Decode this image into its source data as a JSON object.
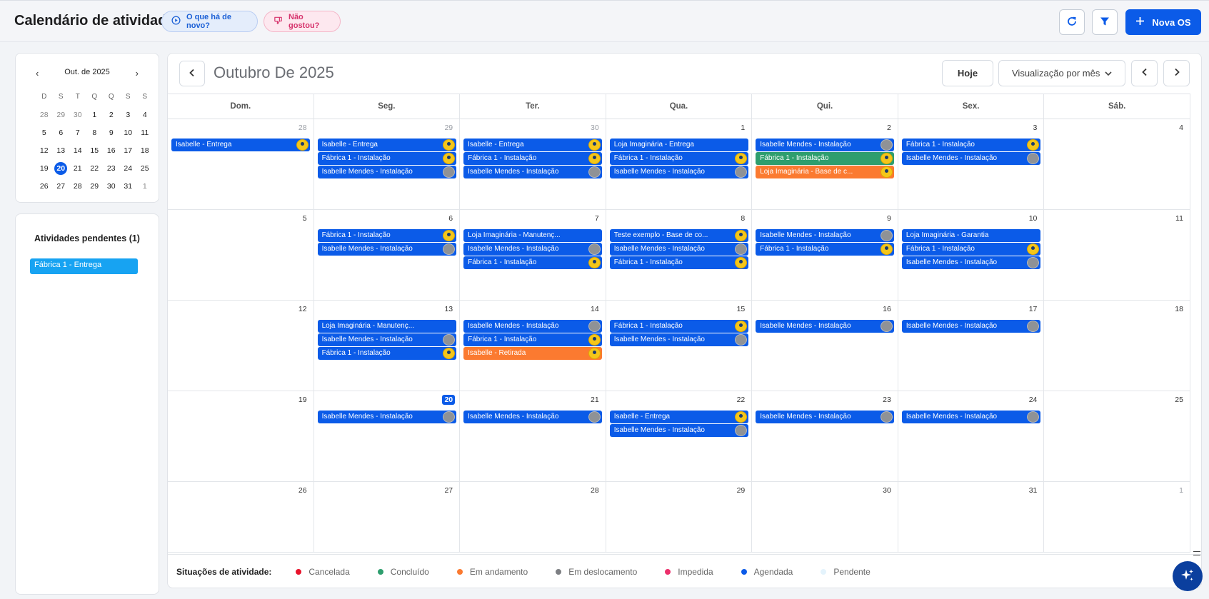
{
  "header": {
    "title": "Calendário de atividades",
    "whats_new": "O que há de novo?",
    "dislike": "Não gostou?",
    "new_os": "Nova OS"
  },
  "mini_calendar": {
    "title": "Out. de 2025",
    "dow": [
      "D",
      "S",
      "T",
      "Q",
      "Q",
      "S",
      "S"
    ],
    "rows": [
      [
        "28",
        "29",
        "30",
        "1",
        "2",
        "3",
        "4"
      ],
      [
        "5",
        "6",
        "7",
        "8",
        "9",
        "10",
        "11"
      ],
      [
        "12",
        "13",
        "14",
        "15",
        "16",
        "17",
        "18"
      ],
      [
        "19",
        "20",
        "21",
        "22",
        "23",
        "24",
        "25"
      ],
      [
        "26",
        "27",
        "28",
        "29",
        "30",
        "31",
        "1"
      ]
    ],
    "selected": "20"
  },
  "pending": {
    "title": "Atividades pendentes (1)",
    "items": [
      "Fábrica 1 - Entrega"
    ]
  },
  "calendar": {
    "title": "Outubro De 2025",
    "today_label": "Hoje",
    "view_label": "Visualização por mês",
    "weekdays": [
      "Dom.",
      "Seg.",
      "Ter.",
      "Qua.",
      "Qui.",
      "Sex.",
      "Sáb."
    ],
    "weeks": [
      [
        {
          "day": "28",
          "muted": true,
          "events": [
            {
              "t": "Isabelle - Entrega",
              "c": "blue",
              "a": "yellow"
            }
          ]
        },
        {
          "day": "29",
          "muted": true,
          "events": [
            {
              "t": "Isabelle - Entrega",
              "c": "blue",
              "a": "yellow"
            },
            {
              "t": "Fábrica 1 - Instalação",
              "c": "blue",
              "a": "yellow"
            },
            {
              "t": "Isabelle Mendes - Instalação",
              "c": "blue",
              "a": "gray"
            }
          ]
        },
        {
          "day": "30",
          "muted": true,
          "events": [
            {
              "t": "Isabelle - Entrega",
              "c": "blue",
              "a": "yellow"
            },
            {
              "t": "Fábrica 1 - Instalação",
              "c": "blue",
              "a": "yellow"
            },
            {
              "t": "Isabelle Mendes - Instalação",
              "c": "blue",
              "a": "gray"
            }
          ]
        },
        {
          "day": "1",
          "events": [
            {
              "t": "Loja Imaginária - Entrega",
              "c": "blue",
              "a": ""
            },
            {
              "t": "Fábrica 1 - Instalação",
              "c": "blue",
              "a": "yellow"
            },
            {
              "t": "Isabelle Mendes - Instalação",
              "c": "blue",
              "a": "gray"
            }
          ]
        },
        {
          "day": "2",
          "events": [
            {
              "t": "Isabelle Mendes - Instalação",
              "c": "blue",
              "a": "gray"
            },
            {
              "t": "Fábrica 1 - Instalação",
              "c": "green",
              "a": "yellow"
            },
            {
              "t": "Loja Imaginária - Base de c...",
              "c": "orange",
              "a": "yellow"
            }
          ]
        },
        {
          "day": "3",
          "events": [
            {
              "t": "Fábrica 1 - Instalação",
              "c": "blue",
              "a": "yellow"
            },
            {
              "t": "Isabelle Mendes - Instalação",
              "c": "blue",
              "a": "gray"
            }
          ]
        },
        {
          "day": "4",
          "events": []
        }
      ],
      [
        {
          "day": "5",
          "events": []
        },
        {
          "day": "6",
          "events": [
            {
              "t": "Fábrica 1 - Instalação",
              "c": "blue",
              "a": "yellow"
            },
            {
              "t": "Isabelle Mendes - Instalação",
              "c": "blue",
              "a": "gray"
            }
          ]
        },
        {
          "day": "7",
          "events": [
            {
              "t": "Loja Imaginária - Manutenç...",
              "c": "blue",
              "a": ""
            },
            {
              "t": "Isabelle Mendes - Instalação",
              "c": "blue",
              "a": "gray"
            },
            {
              "t": "Fábrica 1 - Instalação",
              "c": "blue",
              "a": "yellow"
            }
          ]
        },
        {
          "day": "8",
          "events": [
            {
              "t": "Teste exemplo - Base de co...",
              "c": "blue",
              "a": "yellow"
            },
            {
              "t": "Isabelle Mendes - Instalação",
              "c": "blue",
              "a": "gray"
            },
            {
              "t": "Fábrica 1 - Instalação",
              "c": "blue",
              "a": "yellow"
            }
          ]
        },
        {
          "day": "9",
          "events": [
            {
              "t": "Isabelle Mendes - Instalação",
              "c": "blue",
              "a": "gray"
            },
            {
              "t": "Fábrica 1 - Instalação",
              "c": "blue",
              "a": "yellow"
            }
          ]
        },
        {
          "day": "10",
          "events": [
            {
              "t": "Loja Imaginária - Garantia",
              "c": "blue",
              "a": ""
            },
            {
              "t": "Fábrica 1 - Instalação",
              "c": "blue",
              "a": "yellow"
            },
            {
              "t": "Isabelle Mendes - Instalação",
              "c": "blue",
              "a": "gray"
            }
          ]
        },
        {
          "day": "11",
          "events": []
        }
      ],
      [
        {
          "day": "12",
          "events": []
        },
        {
          "day": "13",
          "events": [
            {
              "t": "Loja Imaginária - Manutenç...",
              "c": "blue",
              "a": ""
            },
            {
              "t": "Isabelle Mendes - Instalação",
              "c": "blue",
              "a": "gray"
            },
            {
              "t": "Fábrica 1 - Instalação",
              "c": "blue",
              "a": "yellow"
            }
          ]
        },
        {
          "day": "14",
          "events": [
            {
              "t": "Isabelle Mendes - Instalação",
              "c": "blue",
              "a": "gray"
            },
            {
              "t": "Fábrica 1 - Instalação",
              "c": "blue",
              "a": "yellow"
            },
            {
              "t": "Isabelle - Retirada",
              "c": "orange",
              "a": "yellow"
            }
          ]
        },
        {
          "day": "15",
          "events": [
            {
              "t": "Fábrica 1 - Instalação",
              "c": "blue",
              "a": "yellow"
            },
            {
              "t": "Isabelle Mendes - Instalação",
              "c": "blue",
              "a": "gray"
            }
          ]
        },
        {
          "day": "16",
          "events": [
            {
              "t": "Isabelle Mendes - Instalação",
              "c": "blue",
              "a": "gray"
            }
          ]
        },
        {
          "day": "17",
          "events": [
            {
              "t": "Isabelle Mendes - Instalação",
              "c": "blue",
              "a": "gray"
            }
          ]
        },
        {
          "day": "18",
          "events": []
        }
      ],
      [
        {
          "day": "19",
          "events": []
        },
        {
          "day": "20",
          "today": true,
          "events": [
            {
              "t": "Isabelle Mendes - Instalação",
              "c": "blue",
              "a": "gray"
            }
          ]
        },
        {
          "day": "21",
          "events": [
            {
              "t": "Isabelle Mendes - Instalação",
              "c": "blue",
              "a": "gray"
            }
          ]
        },
        {
          "day": "22",
          "events": [
            {
              "t": "Isabelle - Entrega",
              "c": "blue",
              "a": "yellow"
            },
            {
              "t": "Isabelle Mendes - Instalação",
              "c": "blue",
              "a": "gray"
            }
          ]
        },
        {
          "day": "23",
          "events": [
            {
              "t": "Isabelle Mendes - Instalação",
              "c": "blue",
              "a": "gray"
            }
          ]
        },
        {
          "day": "24",
          "events": [
            {
              "t": "Isabelle Mendes - Instalação",
              "c": "blue",
              "a": "gray"
            }
          ]
        },
        {
          "day": "25",
          "events": []
        }
      ],
      [
        {
          "day": "26",
          "events": []
        },
        {
          "day": "27",
          "events": []
        },
        {
          "day": "28",
          "events": []
        },
        {
          "day": "29",
          "events": []
        },
        {
          "day": "30",
          "events": []
        },
        {
          "day": "31",
          "events": []
        },
        {
          "day": "1",
          "muted": true,
          "events": []
        }
      ]
    ]
  },
  "legend": {
    "title": "Situações de atividade:",
    "items": [
      {
        "label": "Cancelada",
        "color": "#e8132b"
      },
      {
        "label": "Concluído",
        "color": "#2e9e6e"
      },
      {
        "label": "Em andamento",
        "color": "#fb7a30"
      },
      {
        "label": "Em deslocamento",
        "color": "#7d7f83"
      },
      {
        "label": "Impedida",
        "color": "#ec2f6b"
      },
      {
        "label": "Agendada",
        "color": "#0b5be8"
      },
      {
        "label": "Pendente",
        "color": "#e4f3fc"
      }
    ]
  },
  "colors": {
    "accent": "#0b5be8",
    "event_blue": "#0b5be8",
    "event_green": "#2e9e6e",
    "event_orange": "#fb7a30",
    "pending_item": "#17a3f2"
  },
  "icons": {
    "whats_new": "play-circle-icon",
    "dislike": "thumbs-down-icon",
    "refresh": "refresh-icon",
    "filter": "filter-icon",
    "new": "plus-icon",
    "ai": "sparkles-icon"
  }
}
